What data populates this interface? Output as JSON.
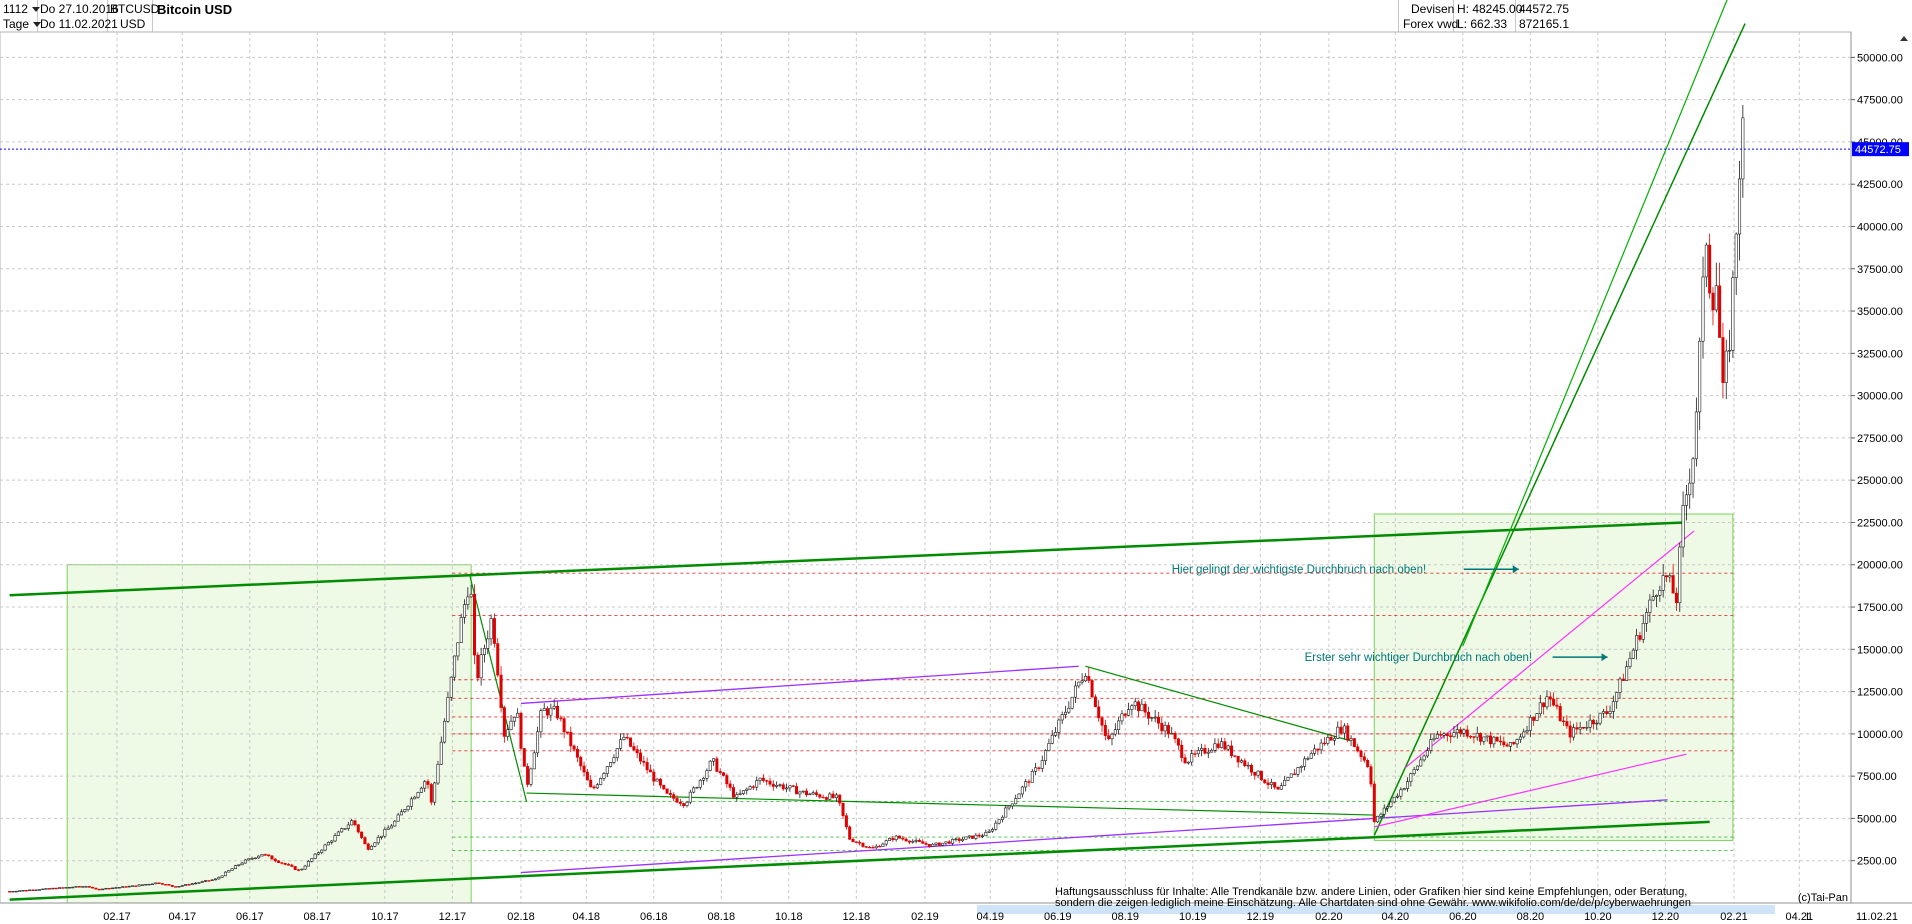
{
  "header": {
    "period_value": "1112",
    "interval_value": "Tage",
    "from_date": "Do 27.10.2016",
    "to_date": "Do 11.02.2021",
    "symbol": "BTCUSD",
    "currency": "USD",
    "title": "Bitcoin USD",
    "market": "Devisen",
    "exchange": "Forex vwd",
    "high": "H: 48245.00",
    "low": "L: 662.33",
    "last_price": "44572.75",
    "volume": "872165.1"
  },
  "colors": {
    "up_candle": "#1a1a1a",
    "down_candle": "#e00000",
    "trendline": "#008c00",
    "channel": "#00c000",
    "support_line": "#9b30ff",
    "current_price_line": "#0000ff",
    "note_text": "#007878",
    "highlight_box": "#eaf8e0"
  },
  "chart_data": {
    "type": "candlestick",
    "title": "Bitcoin USD",
    "interval": "Tage",
    "ylim": [
      0,
      51500
    ],
    "y_ticks": [
      2500,
      5000,
      7500,
      10000,
      12500,
      15000,
      17500,
      20000,
      22500,
      25000,
      27500,
      30000,
      32500,
      35000,
      37500,
      40000,
      42500,
      45000,
      47500,
      50000
    ],
    "y_tick_labels": [
      "2500.00",
      "5000.00",
      "7500.00",
      "10000.00",
      "12500.00",
      "15000.00",
      "17500.00",
      "20000.00",
      "22500.00",
      "25000.00",
      "27500.00",
      "30000.00",
      "32500.00",
      "35000.00",
      "37500.00",
      "40000.00",
      "42500.00",
      "45000.00",
      "47500.00",
      "50000.00"
    ],
    "x_ticks": [
      {
        "label": "02.17",
        "date": "2017-02-01"
      },
      {
        "label": "04.17",
        "date": "2017-04-01"
      },
      {
        "label": "06.17",
        "date": "2017-06-01"
      },
      {
        "label": "08.17",
        "date": "2017-08-01"
      },
      {
        "label": "10.17",
        "date": "2017-10-01"
      },
      {
        "label": "12.17",
        "date": "2017-12-01"
      },
      {
        "label": "02.18",
        "date": "2018-02-01"
      },
      {
        "label": "04.18",
        "date": "2018-04-01"
      },
      {
        "label": "06.18",
        "date": "2018-06-01"
      },
      {
        "label": "08.18",
        "date": "2018-08-01"
      },
      {
        "label": "10.18",
        "date": "2018-10-01"
      },
      {
        "label": "12.18",
        "date": "2018-12-01"
      },
      {
        "label": "02.19",
        "date": "2019-02-01"
      },
      {
        "label": "04.19",
        "date": "2019-04-01"
      },
      {
        "label": "06.19",
        "date": "2019-06-01"
      },
      {
        "label": "08.19",
        "date": "2019-08-01"
      },
      {
        "label": "10.19",
        "date": "2019-10-01"
      },
      {
        "label": "12.19",
        "date": "2019-12-01"
      },
      {
        "label": "02.20",
        "date": "2020-02-01"
      },
      {
        "label": "04.20",
        "date": "2020-04-01"
      },
      {
        "label": "06.20",
        "date": "2020-06-01"
      },
      {
        "label": "08.20",
        "date": "2020-08-01"
      },
      {
        "label": "10.20",
        "date": "2020-10-01"
      },
      {
        "label": "12.20",
        "date": "2020-12-01"
      },
      {
        "label": "02.21",
        "date": "2021-02-01"
      },
      {
        "label": "04.21",
        "date": "2021-04-01"
      }
    ],
    "x_end_label": "11.02.21",
    "axis_flag": "L",
    "current_price": 44572.75,
    "current_price_label": "44572.75",
    "grid": true,
    "price_path": [
      [
        "2016-10-27",
        690
      ],
      [
        "2017-01-05",
        1000
      ],
      [
        "2017-01-12",
        800
      ],
      [
        "2017-02-15",
        1000
      ],
      [
        "2017-03-10",
        1200
      ],
      [
        "2017-03-25",
        950
      ],
      [
        "2017-05-01",
        1400
      ],
      [
        "2017-05-25",
        2400
      ],
      [
        "2017-06-12",
        2900
      ],
      [
        "2017-07-16",
        1900
      ],
      [
        "2017-08-05",
        3200
      ],
      [
        "2017-09-02",
        4900
      ],
      [
        "2017-09-15",
        3200
      ],
      [
        "2017-10-10",
        4800
      ],
      [
        "2017-11-08",
        7400
      ],
      [
        "2017-11-12",
        5900
      ],
      [
        "2017-12-07",
        16000
      ],
      [
        "2017-12-17",
        19300
      ],
      [
        "2017-12-22",
        13000
      ],
      [
        "2018-01-06",
        17000
      ],
      [
        "2018-01-17",
        10000
      ],
      [
        "2018-01-28",
        11500
      ],
      [
        "2018-02-06",
        6800
      ],
      [
        "2018-02-20",
        11400
      ],
      [
        "2018-03-05",
        11300
      ],
      [
        "2018-04-06",
        6600
      ],
      [
        "2018-05-05",
        9800
      ],
      [
        "2018-06-12",
        6400
      ],
      [
        "2018-06-29",
        5900
      ],
      [
        "2018-07-24",
        8400
      ],
      [
        "2018-08-14",
        6200
      ],
      [
        "2018-09-05",
        7300
      ],
      [
        "2018-10-15",
        6500
      ],
      [
        "2018-11-14",
        6200
      ],
      [
        "2018-11-25",
        3800
      ],
      [
        "2018-12-15",
        3200
      ],
      [
        "2019-01-05",
        3900
      ],
      [
        "2019-02-07",
        3400
      ],
      [
        "2019-03-30",
        4100
      ],
      [
        "2019-05-14",
        8000
      ],
      [
        "2019-06-26",
        13800
      ],
      [
        "2019-07-16",
        9400
      ],
      [
        "2019-08-06",
        12000
      ],
      [
        "2019-09-10",
        10100
      ],
      [
        "2019-09-25",
        8400
      ],
      [
        "2019-10-25",
        9500
      ],
      [
        "2019-12-17",
        6600
      ],
      [
        "2020-01-15",
        8800
      ],
      [
        "2020-02-13",
        10400
      ],
      [
        "2020-03-09",
        8000
      ],
      [
        "2020-03-13",
        4800
      ],
      [
        "2020-04-10",
        7000
      ],
      [
        "2020-05-08",
        9900
      ],
      [
        "2020-06-01",
        10200
      ],
      [
        "2020-07-15",
        9200
      ],
      [
        "2020-08-17",
        12300
      ],
      [
        "2020-09-05",
        10000
      ],
      [
        "2020-10-10",
        11300
      ],
      [
        "2020-10-21",
        12900
      ],
      [
        "2020-11-25",
        19000
      ],
      [
        "2020-12-02",
        19200
      ],
      [
        "2020-12-11",
        18000
      ],
      [
        "2020-12-17",
        23000
      ],
      [
        "2020-12-27",
        27000
      ],
      [
        "2021-01-08",
        40600
      ],
      [
        "2021-01-12",
        33000
      ],
      [
        "2021-01-14",
        39000
      ],
      [
        "2021-01-22",
        30000
      ],
      [
        "2021-01-29",
        34000
      ],
      [
        "2021-02-08",
        46000
      ],
      [
        "2021-02-11",
        44572.75
      ]
    ],
    "annotations": [
      {
        "text": "Hier gelingt der wichtigste Durchbruch nach oben!",
        "date": "2019-09-12",
        "price": 19500
      },
      {
        "text": "Erster sehr wichtiger Durchbruch nach oben!",
        "date": "2020-01-10",
        "price": 14300
      }
    ],
    "highlight_boxes": [
      {
        "from": "2016-12-18",
        "to": "2017-12-18",
        "low": 0,
        "high": 20000
      },
      {
        "from": "2020-03-13",
        "to": "2021-01-31",
        "low": 3700,
        "high": 23000
      }
    ],
    "horizontal_levels": [
      {
        "price": 19500,
        "style": "dashed",
        "color": "#e00000"
      },
      {
        "price": 17000,
        "style": "dashed",
        "color": "#e00000"
      },
      {
        "price": 13200,
        "style": "dashed",
        "color": "#e00000"
      },
      {
        "price": 12100,
        "style": "dashed",
        "color": "#e00000"
      },
      {
        "price": 11000,
        "style": "dashed",
        "color": "#e00000"
      },
      {
        "price": 10000,
        "style": "dashed",
        "color": "#e00000"
      },
      {
        "price": 9000,
        "style": "dashed",
        "color": "#e00000"
      },
      {
        "price": 6000,
        "style": "dashed",
        "color": "#00b000"
      },
      {
        "price": 3100,
        "style": "dashed",
        "color": "#00b000"
      },
      {
        "price": 3900,
        "style": "dashed",
        "color": "#00b000"
      }
    ],
    "trendlines": [
      {
        "from": [
          "2016-10-27",
          18200
        ],
        "to": [
          "2020-12-18",
          22500
        ],
        "color": "#008c00",
        "width": 2.5
      },
      {
        "from": [
          "2016-10-27",
          200
        ],
        "to": [
          "2021-01-10",
          4800
        ],
        "color": "#008c00",
        "width": 2.5
      },
      {
        "from": [
          "2018-02-01",
          11800
        ],
        "to": [
          "2019-06-20",
          14000
        ],
        "color": "#9b30ff",
        "width": 1.3
      },
      {
        "from": [
          "2018-02-01",
          1800
        ],
        "to": [
          "2020-12-03",
          6100
        ],
        "color": "#9b30ff",
        "width": 1.3
      },
      {
        "from": [
          "2020-03-13",
          4000
        ],
        "to": [
          "2021-02-11",
          52000
        ],
        "color": "#008c00",
        "width": 1.5
      },
      {
        "from": [
          "2020-06-01",
          15200
        ],
        "to": [
          "2021-02-11",
          56000
        ],
        "color": "#00b000",
        "width": 1.2
      },
      {
        "from": [
          "2019-06-26",
          14000
        ],
        "to": [
          "2020-02-20",
          9600
        ],
        "color": "#008c00",
        "width": 1.2
      },
      {
        "from": [
          "2018-02-06",
          6500
        ],
        "to": [
          "2020-03-13",
          5200
        ],
        "color": "#008c00",
        "width": 1.2
      },
      {
        "from": [
          "2017-12-17",
          19300
        ],
        "to": [
          "2018-02-06",
          6000
        ],
        "color": "#008c00",
        "width": 1.2
      },
      {
        "from": [
          "2020-03-13",
          4500
        ],
        "to": [
          "2020-12-20",
          8800
        ],
        "color": "#ff30ff",
        "width": 1.2
      },
      {
        "from": [
          "2020-04-10",
          8000
        ],
        "to": [
          "2020-12-27",
          22000
        ],
        "color": "#ff30ff",
        "width": 1.2
      }
    ],
    "disclaimer_lines": [
      "Haftungsausschluss für Inhalte: Alle Trendkanäle bzw. andere Linien, oder Grafiken hier sind keine Empfehlungen, oder Beratung,",
      "sondern die zeigen lediglich meine  Einschätzung. Alle Chartdaten sind ohne Gewähr.  www.wikifolio.com/de/de/p/cyberwaehrungen"
    ],
    "copyright": "(c)Tai-Pan"
  }
}
